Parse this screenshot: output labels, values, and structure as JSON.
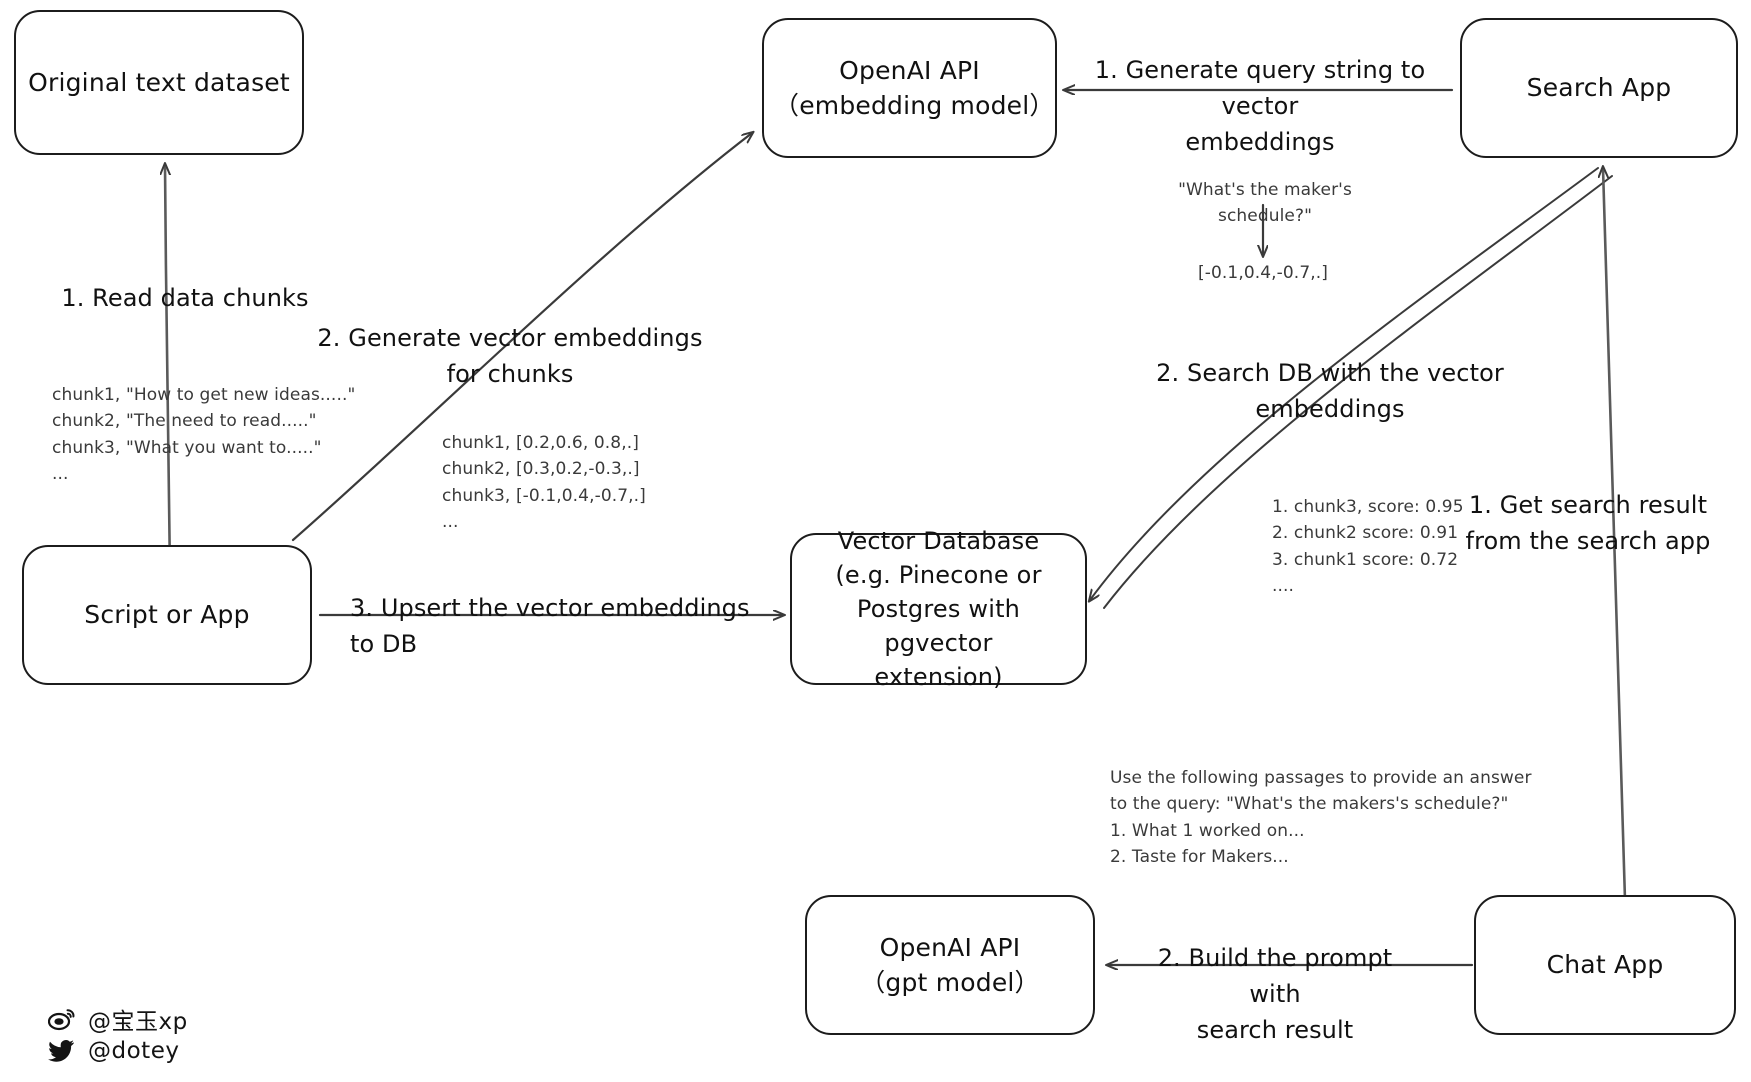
{
  "diagram": {
    "title": "Retrieval augmented generation with vector embeddings",
    "stroke_color": "#1c1c1c",
    "note_color": "#3a3a3a",
    "background": "#ffffff"
  },
  "nodes": [
    {
      "id": "original-text-dataset",
      "label": "Original text dataset"
    },
    {
      "id": "script-or-app",
      "label": "Script or App"
    },
    {
      "id": "openai-embedding",
      "label": "OpenAI API\n（embedding model）"
    },
    {
      "id": "vector-database",
      "label": "Vector Database\n(e.g. Pinecone or\nPostgres with pgvector\nextension)"
    },
    {
      "id": "search-app",
      "label": "Search App"
    },
    {
      "id": "chat-app",
      "label": "Chat App"
    },
    {
      "id": "openai-gpt",
      "label": "OpenAI API\n（gpt model）"
    }
  ],
  "edge_labels": [
    {
      "id": "read-data-chunks",
      "text": "1. Read data chunks"
    },
    {
      "id": "generate-vector-embeddings",
      "text": "2. Generate vector embeddings for chunks"
    },
    {
      "id": "upsert-embeddings",
      "text": "3. Upsert the vector embeddings  to DB"
    },
    {
      "id": "generate-query-string",
      "text": "1. Generate query string to vector\nembeddings"
    },
    {
      "id": "search-db",
      "text": "2. Search DB with the vector embeddings"
    },
    {
      "id": "get-search-result",
      "text": "1. Get search result\nfrom the search app"
    },
    {
      "id": "build-prompt",
      "text": "2. Build the prompt with\nsearch result"
    }
  ],
  "notes": [
    {
      "id": "chunks-sample",
      "text": "chunk1, \"How to get new ideas.....\"\nchunk2, \"The need to read.....\"\nchunk3, \"What you want to.....\"\n..."
    },
    {
      "id": "chunk-embeddings-sample",
      "text": "chunk1, [0.2,0.6, 0.8,.]\nchunk2, [0.3,0.2,-0.3,.]\nchunk3, [-0.1,0.4,-0.7,.]\n..."
    },
    {
      "id": "query-string",
      "text": "\"What's the maker's schedule?\""
    },
    {
      "id": "query-embedding",
      "text": "[-0.1,0.4,-0.7,.]"
    },
    {
      "id": "search-results",
      "text": "1. chunk3, score: 0.95\n2. chunk2 score: 0.91\n3. chunk1 score: 0.72\n...."
    },
    {
      "id": "prompt-sample",
      "text": "Use the following passages to provide an answer\nto the query: \"What's the makers's schedule?\"\n1. What 1 worked on...\n2. Taste for Makers..."
    }
  ],
  "watermark": {
    "weibo_handle": "@宝玉xp",
    "twitter_handle": "@dotey"
  }
}
